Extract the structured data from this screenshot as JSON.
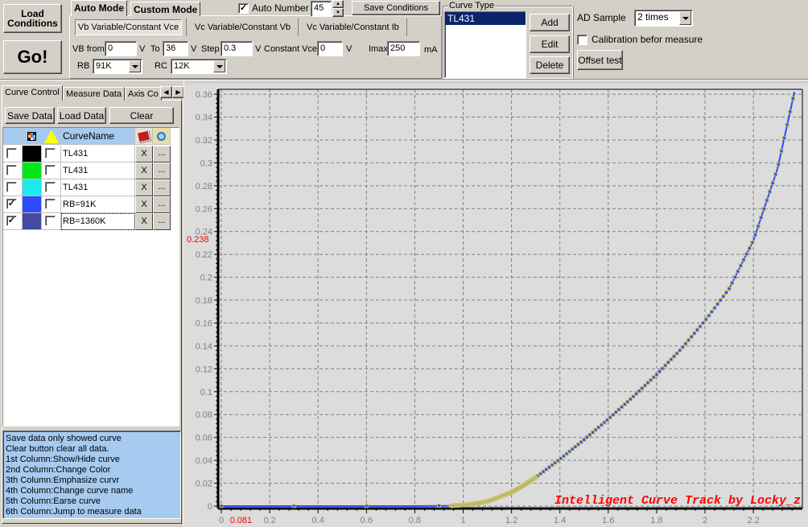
{
  "toolbar": {
    "load_conditions_label": "Load Conditions",
    "go_label": "Go!",
    "mode_tabs": [
      {
        "label": "Auto Mode",
        "active": true
      },
      {
        "label": "Custom Mode",
        "active": false
      }
    ],
    "sub_tabs": [
      {
        "label": "Vb Variable/Constant Vce",
        "active": true
      },
      {
        "label": "Vc Variable/Constant Vb",
        "active": false
      },
      {
        "label": "Vc Variable/Constant Ib",
        "active": false
      }
    ],
    "auto_number": {
      "label": "Auto Number",
      "checked": true,
      "value": "45"
    },
    "save_conditions_label": "Save Conditions",
    "vb_from": {
      "label": "VB from",
      "value": "0",
      "unit": "V"
    },
    "to": {
      "label": "To",
      "value": "36",
      "unit": "V"
    },
    "step": {
      "label": "Step",
      "value": "0.3",
      "unit": "V"
    },
    "constant_vce": {
      "label": "Constant Vce",
      "value": "0",
      "unit": "V"
    },
    "imax": {
      "label": "Imax",
      "value": "250",
      "unit": "mA"
    },
    "rb": {
      "label": "RB",
      "value": "91K"
    },
    "rc": {
      "label": "RC",
      "value": "12K"
    }
  },
  "curve_type": {
    "group_label": "Curve Type",
    "items": [
      "TL431"
    ],
    "selected": "TL431",
    "add_label": "Add",
    "edit_label": "Edit",
    "delete_label": "Delete"
  },
  "ad_sample": {
    "label": "AD Sample",
    "value": "2 times",
    "calibration_label": "Calibration befor measure",
    "calibration_checked": false,
    "offset_test_label": "Offset test"
  },
  "left_panel": {
    "tabs": [
      {
        "label": "Curve Control",
        "active": true
      },
      {
        "label": "Measure Data",
        "active": false
      },
      {
        "label": "Axis Co",
        "active": false
      }
    ],
    "save_data_label": "Save Data",
    "load_data_label": "Load Data",
    "clear_label": "Clear",
    "table_header": {
      "name_col": "CurveName"
    },
    "curves": [
      {
        "visible": false,
        "color": "#000000",
        "emphasized": false,
        "name": "TL431",
        "erase": "X",
        "jump": "..."
      },
      {
        "visible": false,
        "color": "#00e617",
        "emphasized": false,
        "name": "TL431",
        "erase": "X",
        "jump": "..."
      },
      {
        "visible": false,
        "color": "#1ee8ef",
        "emphasized": false,
        "name": "TL431",
        "erase": "X",
        "jump": "..."
      },
      {
        "visible": true,
        "color": "#2d4cf7",
        "emphasized": false,
        "name": "RB=91K",
        "erase": "X",
        "jump": "..."
      },
      {
        "visible": true,
        "color": "#454aa0",
        "emphasized": false,
        "name": "RB=1360K",
        "erase": "X",
        "jump": "..."
      }
    ],
    "help_lines": [
      " Save data only showed curve",
      " Clear button clear all data.",
      "1st Column:Show/Hide curve",
      "2nd Column:Change Color",
      "3th Column:Emphasize curvr",
      "4th Column:Change curve name",
      "5th Column:Earse curve",
      "6th Column:Jump to measure data"
    ]
  },
  "chart_data": {
    "type": "line",
    "title": "",
    "xlabel": "",
    "ylabel": "",
    "xlim": [
      0,
      2.38
    ],
    "ylim": [
      0,
      0.365
    ],
    "grid": true,
    "x_ticks": [
      0,
      0.2,
      0.4,
      0.6,
      0.8,
      1,
      1.2,
      1.4,
      1.6,
      1.8,
      2,
      2.2
    ],
    "x_tick_labels": [
      "0",
      "0.2",
      "0.4",
      "0.6",
      "0.8",
      "1",
      "1.2",
      "1.4",
      "1.6",
      "1.8",
      "2",
      "2.2"
    ],
    "y_ticks": [
      0,
      0.02,
      0.04,
      0.06,
      0.08,
      0.1,
      0.12,
      0.14,
      0.16,
      0.18,
      0.2,
      0.22,
      0.24,
      0.26,
      0.28,
      0.3,
      0.32,
      0.34,
      0.36
    ],
    "y_tick_labels": [
      "0",
      "0.02",
      "0.04",
      "0.06",
      "0.08",
      "0.1",
      "0.12",
      "0.14",
      "0.16",
      "0.18",
      "0.2",
      "0.22",
      "0.24",
      "0.26",
      "0.28",
      "0.3",
      "0.32",
      "0.34",
      "0.36"
    ],
    "cursor_x_label": "0.081",
    "cursor_y_label": "0.238",
    "cursor_color": "#ff0000",
    "watermark": "Intelligent Curve Track by Locky_z",
    "series": [
      {
        "name": "RB=1360K",
        "color": "#2d4cf7",
        "marker_color": "#c8c060",
        "x": [
          0,
          0.2,
          0.4,
          0.6,
          0.8,
          0.95,
          1.0,
          1.05,
          1.1,
          1.15,
          1.2,
          1.25,
          1.3,
          1.35,
          1.4,
          1.5,
          1.6,
          1.7,
          1.8,
          1.9,
          2.0,
          2.1,
          2.2,
          2.3,
          2.37
        ],
        "y": [
          0,
          0,
          0,
          0,
          0,
          0.0003,
          0.001,
          0.002,
          0.004,
          0.008,
          0.012,
          0.018,
          0.025,
          0.033,
          0.041,
          0.058,
          0.076,
          0.095,
          0.115,
          0.137,
          0.162,
          0.19,
          0.232,
          0.295,
          0.362
        ]
      },
      {
        "name": "RB=91K",
        "color": "#c8c060",
        "emphasized": true,
        "x": [
          0.95,
          1.0,
          1.05,
          1.1,
          1.15,
          1.2,
          1.25,
          1.3
        ],
        "y": [
          0.0003,
          0.001,
          0.002,
          0.004,
          0.008,
          0.012,
          0.018,
          0.025
        ]
      }
    ]
  }
}
